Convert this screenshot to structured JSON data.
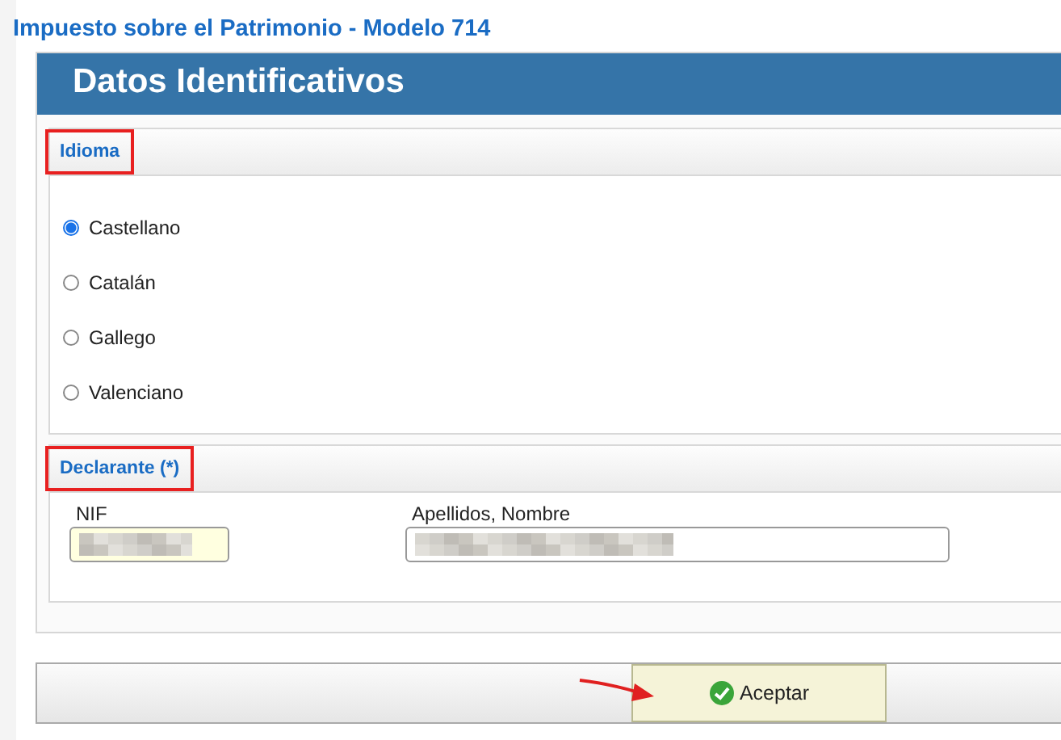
{
  "page_title": "Impuesto sobre el Patrimonio - Modelo 714",
  "panel_title": "Datos Identificativos",
  "sections": [
    {
      "kind": "radios",
      "title": "Idioma",
      "highlighted": true,
      "options": [
        {
          "label": "Castellano",
          "selected": true
        },
        {
          "label": "Catalán",
          "selected": false
        },
        {
          "label": "Gallego",
          "selected": false
        },
        {
          "label": "Valenciano",
          "selected": false
        }
      ]
    },
    {
      "kind": "fields",
      "title": "Declarante (*)",
      "highlighted": true,
      "fields": [
        {
          "label": "NIF",
          "required": true
        },
        {
          "label": "Apellidos, Nombre",
          "required": false
        }
      ]
    }
  ],
  "accept_button": {
    "label": "Aceptar",
    "pointed": true
  }
}
